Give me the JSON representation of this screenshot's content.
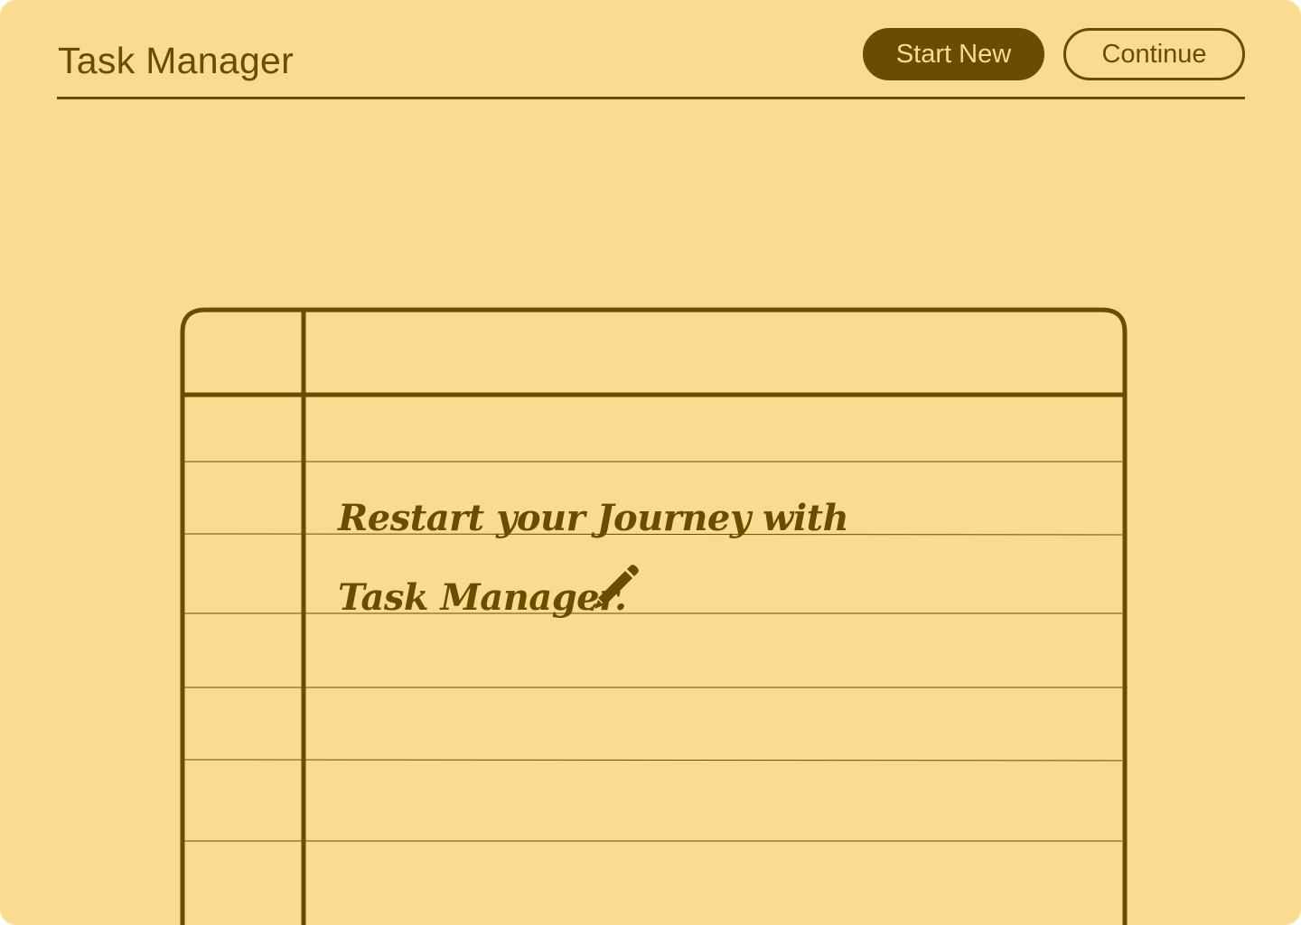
{
  "header": {
    "title": "Task Manager",
    "start_label": "Start New",
    "continue_label": "Continue"
  },
  "notebook": {
    "line1": "Restart your Journey with",
    "line2": "Task Manager."
  },
  "icons": {
    "pencil": "pencil-icon"
  },
  "colors": {
    "background": "#f9dc8f",
    "ink": "#6b4d00"
  }
}
